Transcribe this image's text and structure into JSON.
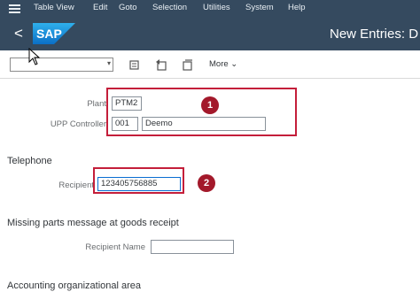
{
  "menu": {
    "items": [
      "Table View",
      "Edit",
      "Goto",
      "Selection",
      "Utilities",
      "System",
      "Help"
    ]
  },
  "header": {
    "back_glyph": "<",
    "logo_text": "SAP",
    "title": "New Entries: D"
  },
  "toolbar": {
    "more_label": "More",
    "more_glyph": "⌄"
  },
  "form": {
    "plant": {
      "label": "Plant",
      "value": "PTM2"
    },
    "ups_controller": {
      "label": "UPP Controller",
      "value1": "001",
      "value2": "Deemo"
    },
    "telephone": {
      "section": "Telephone",
      "recipient_label": "Recipient",
      "recipient_value": "123405756885"
    },
    "missing_parts": {
      "section": "Missing parts message at goods receipt",
      "recipient_label": "Recipient Name",
      "recipient_value": ""
    },
    "accounting_section": "Accounting organizational area"
  },
  "annotations": {
    "badge1": "1",
    "badge2": "2",
    "color": "#c41e3a"
  }
}
